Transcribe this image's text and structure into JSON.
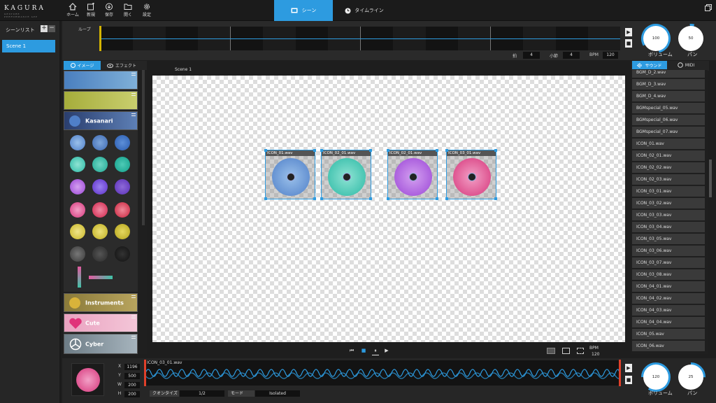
{
  "app": {
    "logo": "KAGURA",
    "logo_sub": "GESTURE PERFORMANCE APP"
  },
  "nav": {
    "home": "ホーム",
    "new": "新規",
    "save": "保存",
    "open": "開く",
    "settings": "設定"
  },
  "main_tabs": {
    "scene": "シーン",
    "timeline": "タイムライン"
  },
  "scenelist": {
    "title": "シーンリスト",
    "add": "+",
    "remove": "−",
    "items": [
      "Scene 1"
    ]
  },
  "loop": {
    "label": "ループ",
    "beat_label": "拍",
    "beat": "4",
    "bar_label": "小節",
    "bar": "4",
    "bpm_label": "BPM",
    "bpm": "120"
  },
  "master": {
    "volume": "100",
    "volume_label": "ボリューム",
    "pan": "50",
    "pan_label": "パン"
  },
  "library": {
    "tab_image": "イメージ",
    "tab_effect": "エフェクト",
    "cat_kasanari": "Kasanari",
    "cat_instruments": "Instruments",
    "cat_cute": "Cute",
    "cat_cyber": "Cyber"
  },
  "canvas": {
    "scene_label": "Scene 1",
    "clips": [
      {
        "name": "ICON_01.wav"
      },
      {
        "name": "ICON_02_01.wav"
      },
      {
        "name": "ICON_02_01.wav"
      },
      {
        "name": "ICON_03_01.wav"
      }
    ]
  },
  "transport": {
    "bpm_label": "BPM",
    "bpm": "120"
  },
  "sound": {
    "tab_sound": "サウンド",
    "tab_midi": "MIDI",
    "items": [
      "BGM_D_2.wav",
      "BGM_D_3.wav",
      "BGM_D_4.wav",
      "BGMspecial_05.wav",
      "BGMspecial_06.wav",
      "BGMspecial_07.wav",
      "ICON_01.wav",
      "ICON_02_01.wav",
      "ICON_02_02.wav",
      "ICON_02_03.wav",
      "ICON_03_01.wav",
      "ICON_03_02.wav",
      "ICON_03_03.wav",
      "ICON_03_04.wav",
      "ICON_03_05.wav",
      "ICON_03_06.wav",
      "ICON_03_07.wav",
      "ICON_03_08.wav",
      "ICON_04_01.wav",
      "ICON_04_02.wav",
      "ICON_04_03.wav",
      "ICON_04_04.wav",
      "ICON_05.wav",
      "ICON_06.wav"
    ]
  },
  "inspector": {
    "x_label": "X",
    "x": "1196",
    "y_label": "Y",
    "y": "500",
    "w_label": "W",
    "w": "200",
    "h_label": "H",
    "h": "200",
    "wave_name": "ICON_03_01.wav",
    "quantize_label": "クオンタイズ",
    "quantize": "1/2",
    "mode_label": "モード",
    "mode": "Isolated",
    "volume": "120",
    "volume_label": "ボリューム",
    "pan": "25",
    "pan_label": "パン"
  },
  "colors": {
    "accent": "#2d9be0"
  }
}
